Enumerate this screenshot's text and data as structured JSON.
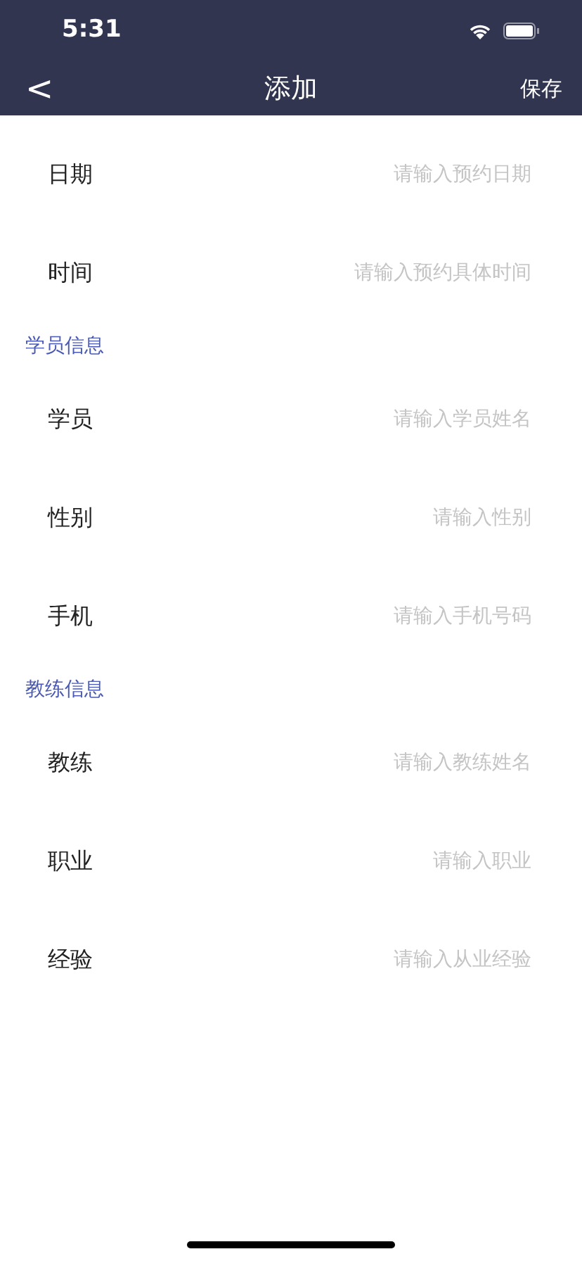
{
  "status_bar": {
    "time": "5:31"
  },
  "nav": {
    "back": "<",
    "title": "添加",
    "action": "保存"
  },
  "sections": [
    {
      "fields": [
        {
          "label": "日期",
          "placeholder": "请输入预约日期"
        },
        {
          "label": "时间",
          "placeholder": "请输入预约具体时间"
        }
      ]
    },
    {
      "header": "学员信息",
      "fields": [
        {
          "label": "学员",
          "placeholder": "请输入学员姓名"
        },
        {
          "label": "性别",
          "placeholder": "请输入性别"
        },
        {
          "label": "手机",
          "placeholder": "请输入手机号码"
        }
      ]
    },
    {
      "header": "教练信息",
      "fields": [
        {
          "label": "教练",
          "placeholder": "请输入教练姓名"
        },
        {
          "label": "职业",
          "placeholder": "请输入职业"
        },
        {
          "label": "经验",
          "placeholder": "请输入从业经验"
        }
      ]
    }
  ]
}
